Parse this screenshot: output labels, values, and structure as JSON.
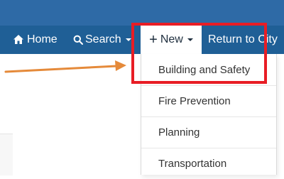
{
  "nav": {
    "home_label": "Home",
    "search_label": "Search",
    "new_label": "New",
    "return_label": "Return to City"
  },
  "dropdown": {
    "items": [
      {
        "label": "Building and Safety"
      },
      {
        "label": "Fire Prevention"
      },
      {
        "label": "Planning"
      },
      {
        "label": "Transportation"
      }
    ]
  },
  "icons": {
    "home": "home-icon",
    "search": "search-icon",
    "plus": "plus-icon",
    "caret": "chevron-down-icon"
  },
  "colors": {
    "header": "#2e6aa6",
    "navbar": "#1f5f96",
    "highlight": "#e81d25",
    "arrow": "#e58a3a"
  }
}
